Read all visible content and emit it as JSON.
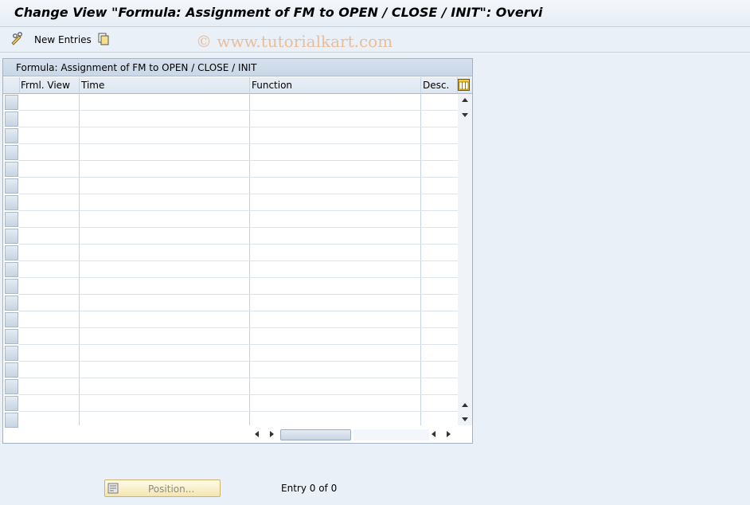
{
  "window": {
    "title": "Change View \"Formula: Assignment of FM to OPEN / CLOSE / INIT\": Overvi"
  },
  "watermark": "© www.tutorialkart.com",
  "toolbar": {
    "new_entries_label": "New Entries",
    "new_entries_icon": "pencil-glasses-icon",
    "copy_icon": "copy-icon"
  },
  "table": {
    "title": "Formula: Assignment of FM to OPEN / CLOSE / INIT",
    "columns": [
      "Frml. View",
      "Time",
      "Function",
      "Desc."
    ],
    "settings_icon": "table-settings-icon",
    "rows": []
  },
  "footer": {
    "position_label": "Position...",
    "entry_text": "Entry 0 of 0"
  }
}
